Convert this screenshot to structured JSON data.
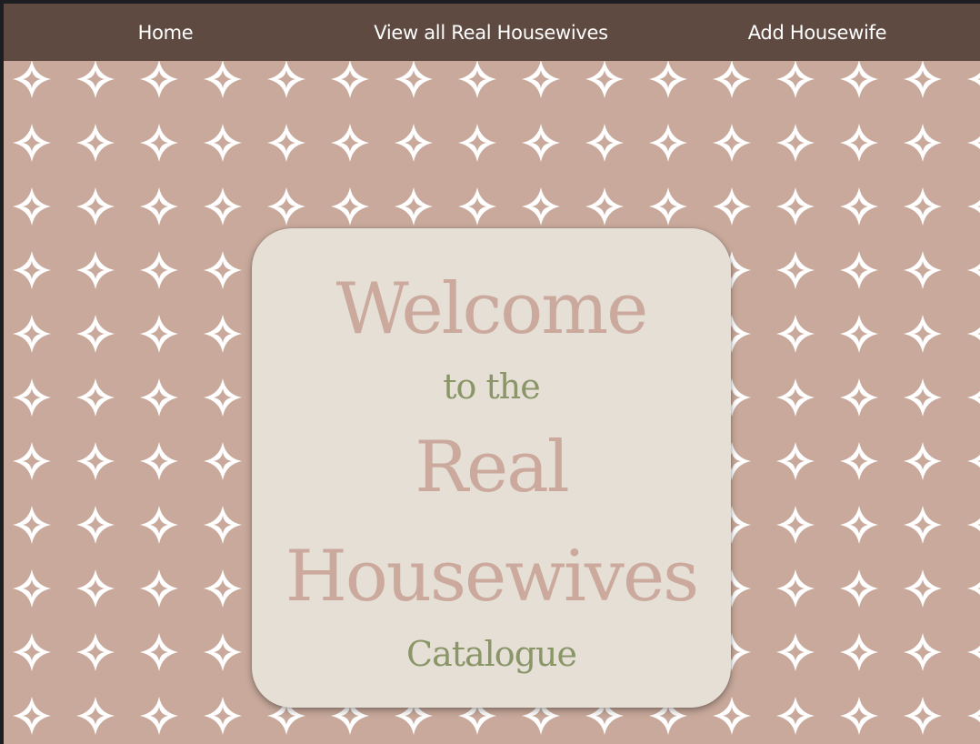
{
  "colors": {
    "navbar_bg": "#5e4a40",
    "page_bg": "#c8a99b",
    "pattern_star": "#ffffff",
    "card_bg": "#e5dfd6",
    "title_pink": "#cba99d",
    "title_green": "#8a9568"
  },
  "nav": {
    "links": [
      {
        "label": "Home",
        "icon": null
      },
      {
        "label": "View all Real Housewives",
        "icon": null
      },
      {
        "label": "Add Housewife",
        "icon": null
      }
    ]
  },
  "hero": {
    "line1": "Welcome",
    "line2": "to the",
    "line3": "Real",
    "line4": "Housewives",
    "line5": "Catalogue"
  },
  "background": {
    "pattern_icon": "four-point-star-icon"
  }
}
